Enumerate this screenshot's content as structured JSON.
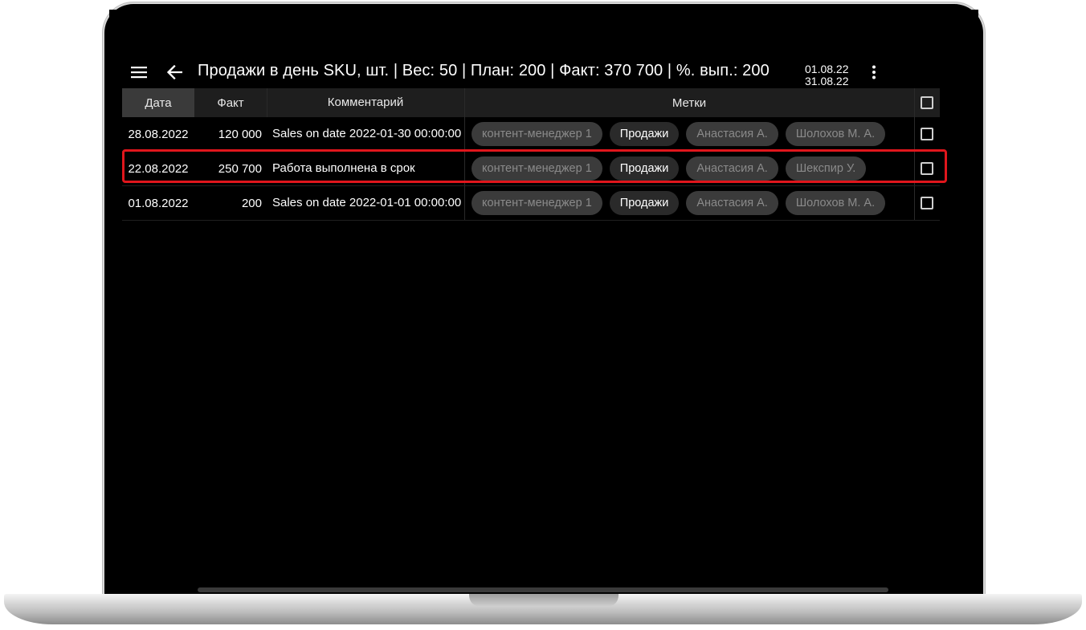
{
  "toolbar": {
    "title": "Продажи в день SKU, шт. | Вес: 50 | План: 200 | Факт: 370 700 | %. вып.: 200",
    "date_from": "01.08.22",
    "date_to": "31.08.22"
  },
  "columns": {
    "date": "Дата",
    "fact": "Факт",
    "comment": "Комментарий",
    "tags": "Метки"
  },
  "rows": [
    {
      "date": "28.08.2022",
      "fact": "120 000",
      "comment": "Sales on date 2022-01-30 00:00:00",
      "tags": [
        {
          "label": "контент-менеджер 1",
          "active": false
        },
        {
          "label": "Продажи",
          "active": true
        },
        {
          "label": "Анастасия А.",
          "active": false
        },
        {
          "label": "Шолохов М. А.",
          "active": false
        }
      ],
      "checked": false
    },
    {
      "date": "22.08.2022",
      "fact": "250 700",
      "comment": "Работа выполнена в срок",
      "tags": [
        {
          "label": "контент-менеджер 1",
          "active": false
        },
        {
          "label": "Продажи",
          "active": true
        },
        {
          "label": "Анастасия А.",
          "active": false
        },
        {
          "label": "Шекспир У.",
          "active": false
        }
      ],
      "checked": false,
      "highlighted": true
    },
    {
      "date": "01.08.2022",
      "fact": "200",
      "comment": "Sales on date 2022-01-01 00:00:00",
      "tags": [
        {
          "label": "контент-менеджер 1",
          "active": false
        },
        {
          "label": "Продажи",
          "active": true
        },
        {
          "label": "Анастасия А.",
          "active": false
        },
        {
          "label": "Шолохов М. А.",
          "active": false
        }
      ],
      "checked": false
    }
  ],
  "colors": {
    "highlight": "#e0161c",
    "tag_inactive_bg": "#3b3b3b",
    "tag_active_bg": "#2a2a2a",
    "header_bg": "#1e1e1e"
  },
  "icons": [
    "menu-icon",
    "arrow-left-icon",
    "more-vertical-icon",
    "checkbox-icon"
  ]
}
